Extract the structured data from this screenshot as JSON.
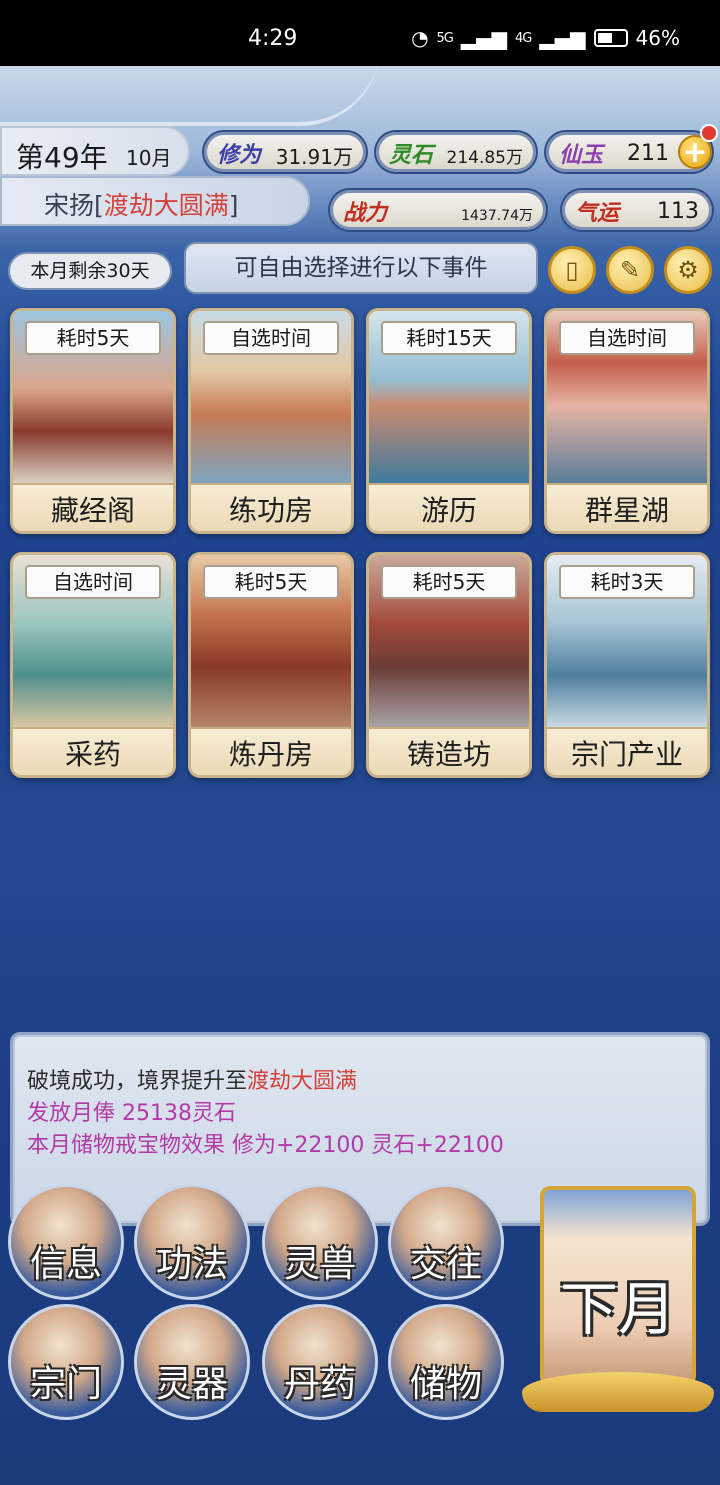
{
  "status_bar": {
    "time": "4:29",
    "signal1": "5G",
    "signal2": "4G",
    "battery": "46%"
  },
  "header": {
    "year": "第49年",
    "month": "10月",
    "player_name": "宋扬",
    "realm": "渡劫大圆满",
    "resources": {
      "xiuwei": {
        "label": "修为",
        "value": "31.91万"
      },
      "lingshi": {
        "label": "灵石",
        "value": "214.85万"
      },
      "xianyu": {
        "label": "仙玉",
        "value": "211"
      },
      "zhanli": {
        "label": "战力",
        "value": "1437.74万"
      },
      "qiyun": {
        "label": "气运",
        "value": "113"
      }
    }
  },
  "toolbar": {
    "days_left": "本月剩余30天",
    "tip": "可自由选择进行以下事件"
  },
  "events": [
    {
      "time": "耗时5天",
      "name": "藏经阁"
    },
    {
      "time": "自选时间",
      "name": "练功房"
    },
    {
      "time": "耗时15天",
      "name": "游历"
    },
    {
      "time": "自选时间",
      "name": "群星湖"
    },
    {
      "time": "自选时间",
      "name": "采药"
    },
    {
      "time": "耗时5天",
      "name": "炼丹房"
    },
    {
      "time": "耗时5天",
      "name": "铸造坊"
    },
    {
      "time": "耗时3天",
      "name": "宗门产业"
    }
  ],
  "messages": {
    "line1_prefix": "破境成功，境界提升至",
    "line1_realm": "渡劫大圆满",
    "line2": "发放月俸 25138灵石",
    "line3": "本月储物戒宝物效果 修为+22100 灵石+22100"
  },
  "menu": [
    {
      "label": "信息"
    },
    {
      "label": "功法"
    },
    {
      "label": "灵兽"
    },
    {
      "label": "交往"
    },
    {
      "label": "宗门"
    },
    {
      "label": "灵器"
    },
    {
      "label": "丹药"
    },
    {
      "label": "储物"
    }
  ],
  "next_month": "下月"
}
